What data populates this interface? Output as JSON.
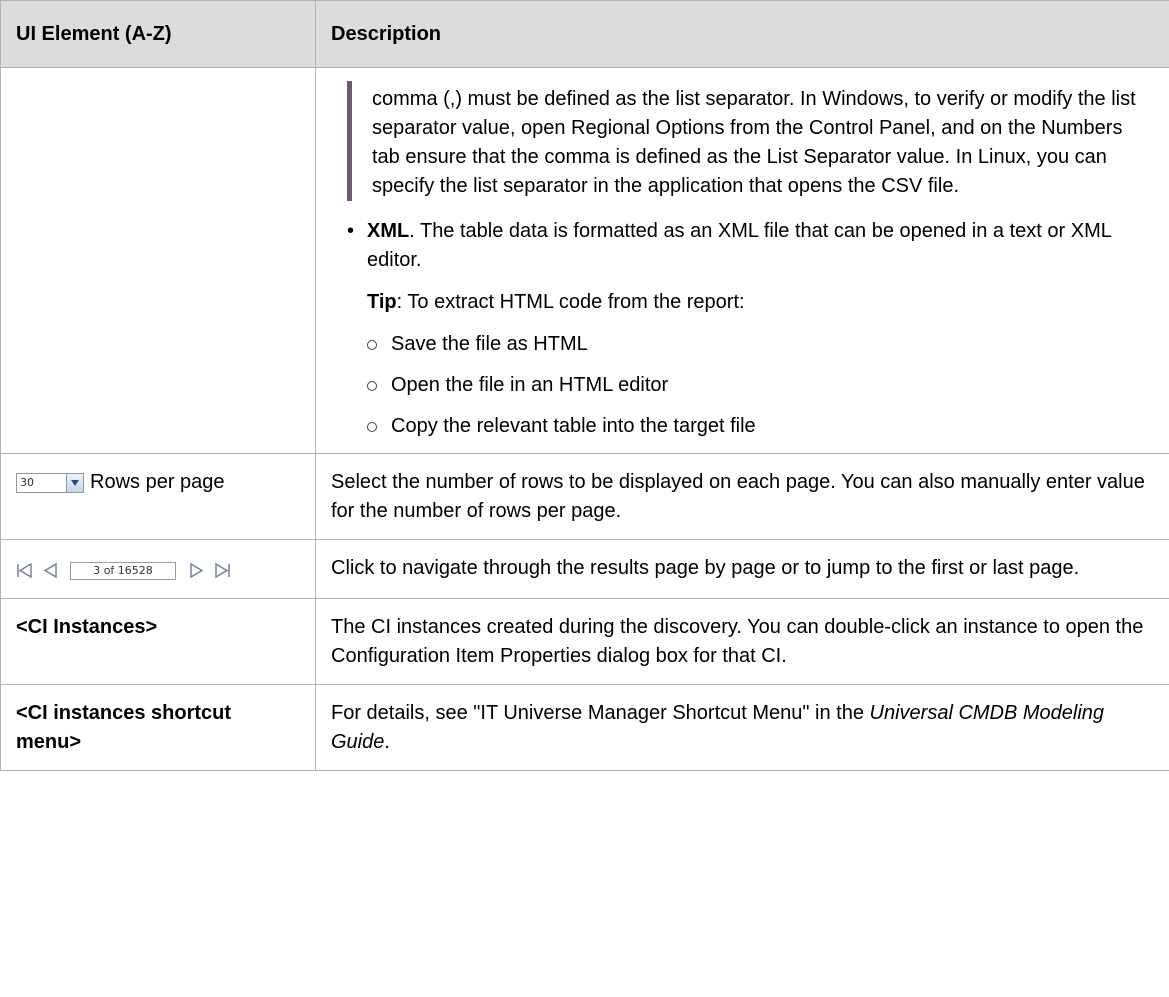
{
  "header": {
    "col1": "UI Element (A-Z)",
    "col2": "Description"
  },
  "row_export": {
    "note_text": "comma (,) must be defined as the list separator. In Windows, to verify or modify the list separator value, open Regional Options from the Control Panel, and on the Numbers tab ensure that the comma is defined as the List Separator value. In Linux, you can specify the list separator in the application that opens the CSV file.",
    "xml_label": "XML",
    "xml_text": ". The table data is formatted as an XML file that can be opened in a text or XML editor.",
    "tip_label": "Tip",
    "tip_text": ": To extract HTML code from the report:",
    "steps": [
      "Save the file as HTML",
      "Open the file in an HTML editor",
      "Copy the relevant table into the target file"
    ]
  },
  "row_rows_per_page": {
    "select_value": "30",
    "label": "Rows per page",
    "description": "Select the number of rows to be displayed on each page. You can also manually enter value for the number of rows per page."
  },
  "row_pager": {
    "page_text": "3 of 16528",
    "description": "Click to navigate through the results page by page or to jump to the first or last page."
  },
  "row_ci_instances": {
    "label": "<CI Instances>",
    "description": "The CI instances created during the discovery. You can double-click an instance to open the Configuration Item Properties dialog box for that CI."
  },
  "row_ci_shortcut": {
    "label": "<CI instances shortcut menu>",
    "desc_prefix": "For details, see \"IT Universe Manager Shortcut Menu\" in the ",
    "desc_italic": "Universal CMDB Modeling Guide",
    "desc_suffix": "."
  },
  "icons": {
    "first_page": "first-page-icon",
    "prev_page": "previous-page-icon",
    "next_page": "next-page-icon",
    "last_page": "last-page-icon",
    "dropdown": "chevron-down-icon"
  },
  "colors": {
    "header_bg": "#dcdcdc",
    "border": "#b3b3b3",
    "note_bar": "#6b5a70"
  }
}
